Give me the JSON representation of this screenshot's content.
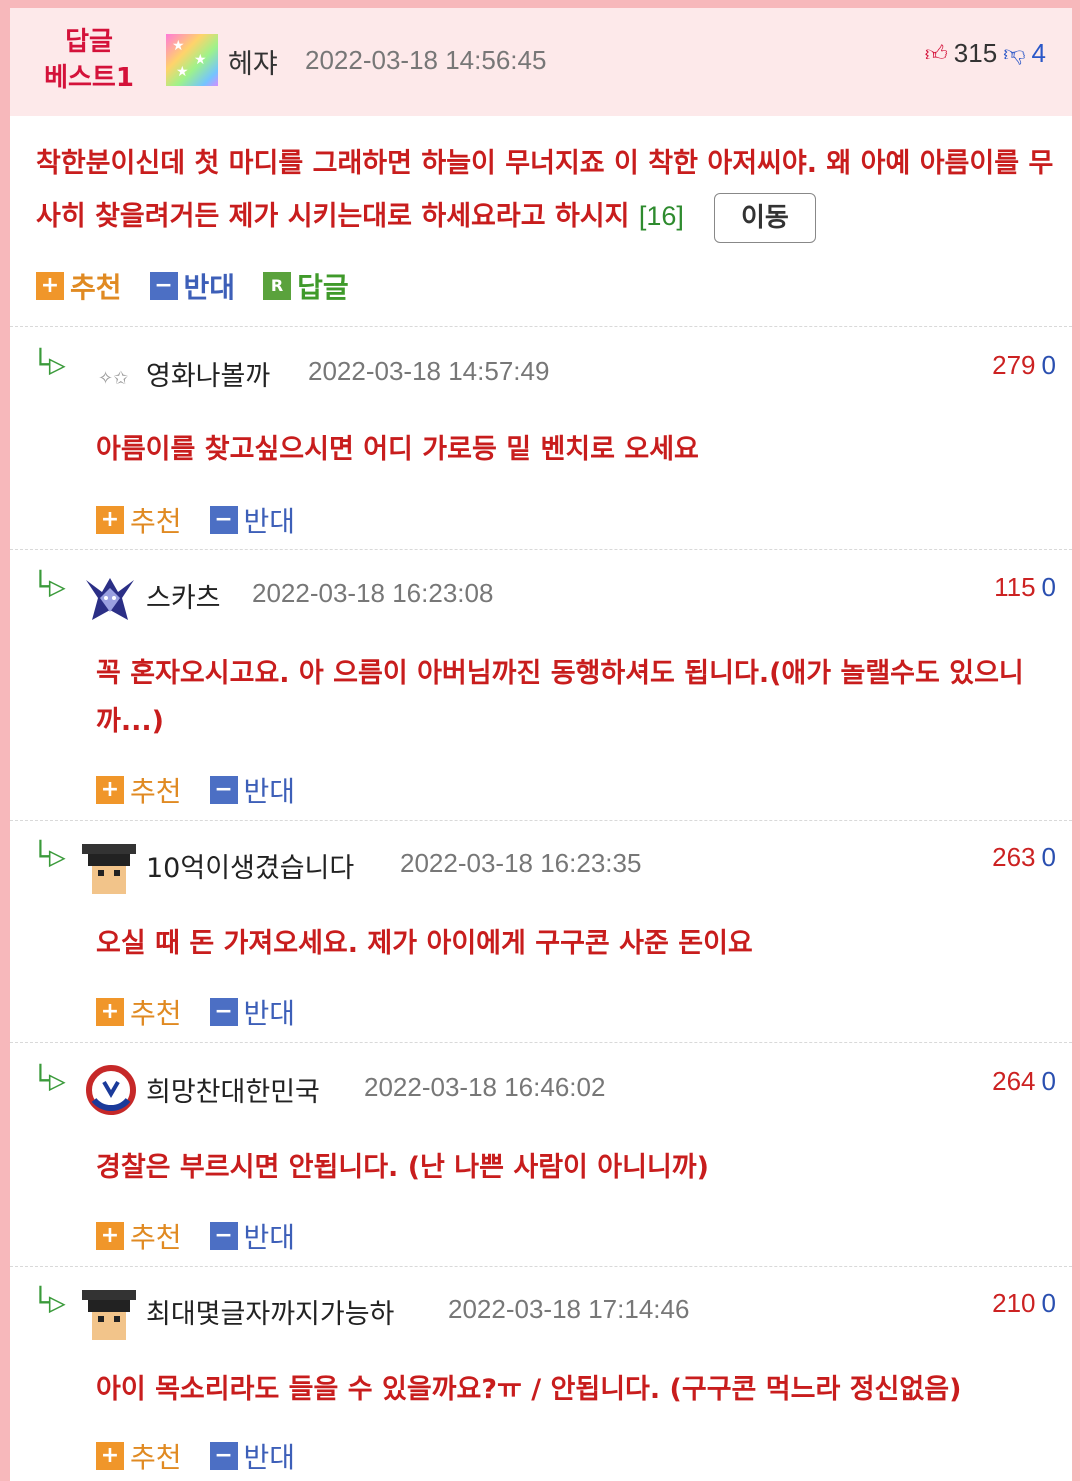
{
  "best": {
    "badge_line1": "답글",
    "badge_line2": "베스트1",
    "author": "헤쟈",
    "date": "2022-03-18 14:56:45",
    "upvotes": "315",
    "downvotes": "4",
    "text": "착한분이신데 첫 마디를 그래하면 하늘이 무너지죠 이 착한 아저씨야. 왜 아예 아름이를 무사히 찾을려거든 제가 시키는대로 하세요라고 하시지",
    "reply_count": "[16]",
    "move_label": "이동",
    "actions": {
      "recommend": "추천",
      "oppose": "반대",
      "reply": "답글",
      "reply_box": "R"
    }
  },
  "comments": [
    {
      "author": "영화나볼까",
      "date": "2022-03-18 14:57:49",
      "up": "279",
      "down": "0",
      "text": "아름이를 찾고싶으시면 어디 가로등 밑 벤치로 오세요",
      "recommend": "추천",
      "oppose": "반대"
    },
    {
      "author": "스카츠",
      "date": "2022-03-18 16:23:08",
      "up": "115",
      "down": "0",
      "text": "꼭 혼자오시고요. 아 으름이 아버님까진 동행하셔도 됩니다.(애가 놀랠수도 있으니까...)",
      "recommend": "추천",
      "oppose": "반대"
    },
    {
      "author": "10억이생겼습니다",
      "date": "2022-03-18 16:23:35",
      "up": "263",
      "down": "0",
      "text": "오실 때 돈 가져오세요. 제가 아이에게 구구콘 사준 돈이요",
      "recommend": "추천",
      "oppose": "반대"
    },
    {
      "author": "희망찬대한민국",
      "date": "2022-03-18 16:46:02",
      "up": "264",
      "down": "0",
      "text": "경찰은 부르시면 안됩니다. (난 나쁜 사람이 아니니까)",
      "recommend": "추천",
      "oppose": "반대"
    },
    {
      "author": "최대몇글자까지가능하",
      "date": "2022-03-18 17:14:46",
      "up": "210",
      "down": "0",
      "text": "아이 목소리라도 들을 수 있을까요?ㅠ / 안됩니다. (구구콘 먹느라 정신없음)",
      "recommend": "추천",
      "oppose": "반대"
    }
  ],
  "icons": {
    "reply_arrow": "reply-arrow-icon",
    "thumb_up": "thumb-up-icon",
    "thumb_down": "thumb-down-icon"
  },
  "colors": {
    "page_border": "#f7b8bb",
    "best_header_bg": "#fde9ea",
    "comment_text": "#c81d1d",
    "recommend_orange": "#f0962a",
    "oppose_blue": "#4c6fc4",
    "reply_green": "#5aa23c"
  }
}
